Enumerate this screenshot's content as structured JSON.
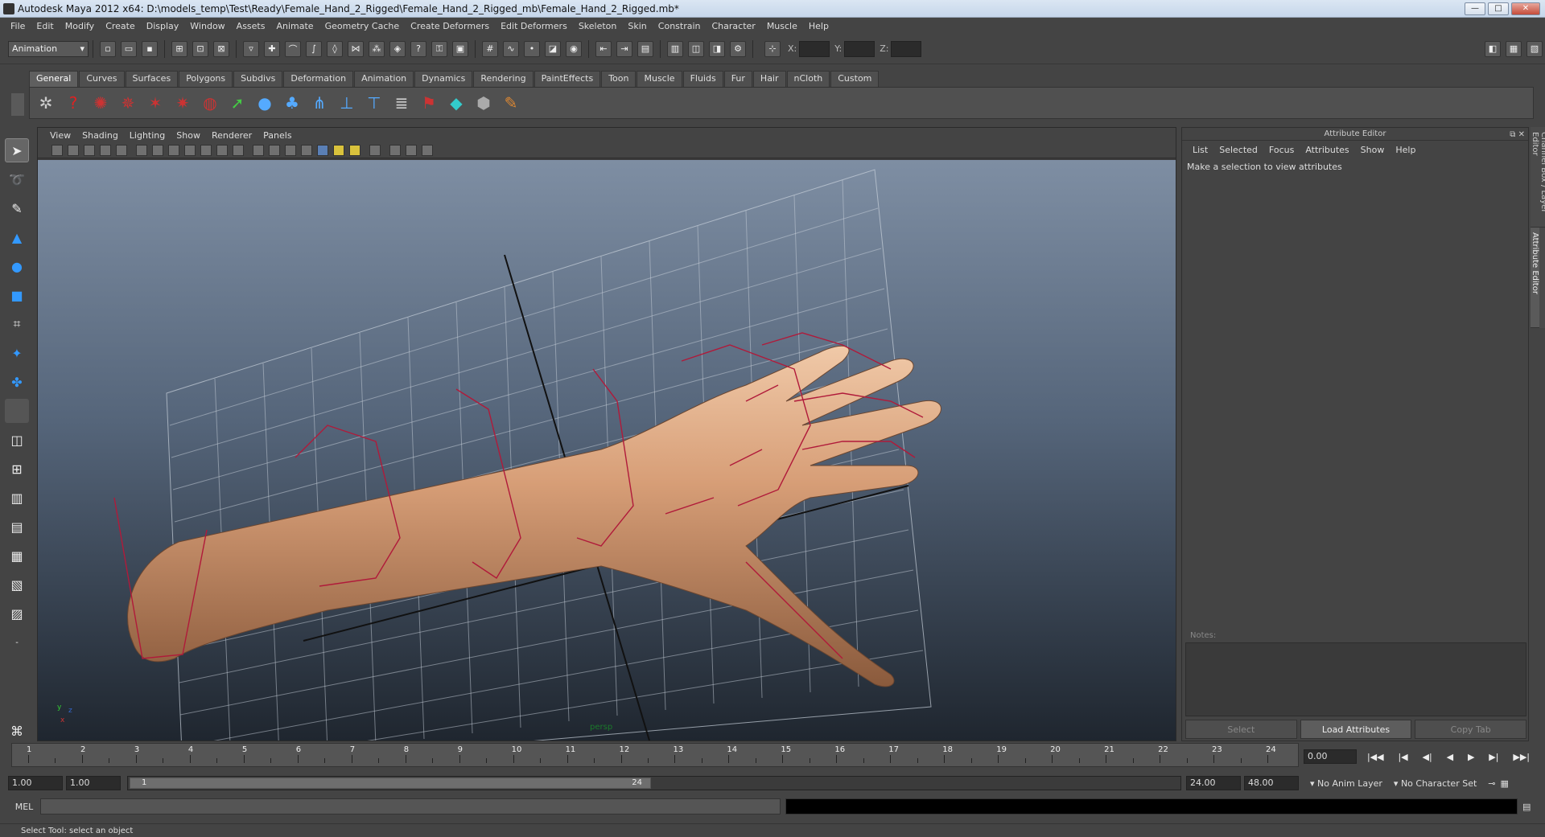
{
  "window": {
    "title": "Autodesk Maya 2012 x64: D:\\models_temp\\Test\\Ready\\Female_Hand_2_Rigged\\Female_Hand_2_Rigged_mb\\Female_Hand_2_Rigged.mb*",
    "min": "—",
    "max": "□",
    "close": "✕"
  },
  "menubar": [
    "File",
    "Edit",
    "Modify",
    "Create",
    "Display",
    "Window",
    "Assets",
    "Animate",
    "Geometry Cache",
    "Create Deformers",
    "Edit Deformers",
    "Skeleton",
    "Skin",
    "Constrain",
    "Character",
    "Muscle",
    "Help"
  ],
  "statusline": {
    "mode": "Animation",
    "x_label": "X:",
    "y_label": "Y:",
    "z_label": "Z:"
  },
  "shelf": {
    "tabs": [
      "General",
      "Curves",
      "Surfaces",
      "Polygons",
      "Subdivs",
      "Deformation",
      "Animation",
      "Dynamics",
      "Rendering",
      "PaintEffects",
      "Toon",
      "Muscle",
      "Fluids",
      "Fur",
      "Hair",
      "nCloth",
      "Custom"
    ],
    "active_tab": "General",
    "icons": [
      "render-icon",
      "help-icon",
      "joint-tool-icon",
      "ik-handle-icon",
      "ik-spline-icon",
      "skin-icon",
      "hypershade-icon",
      "redo-icon",
      "sphere-icon",
      "cluster-icon",
      "lattice-icon",
      "wrap-icon",
      "bend-icon",
      "list-icon",
      "character-icon",
      "shader-icon",
      "paint-icon"
    ]
  },
  "viewport": {
    "menu": [
      "View",
      "Shading",
      "Lighting",
      "Show",
      "Renderer",
      "Panels"
    ],
    "camera": "persp"
  },
  "attribute_editor": {
    "title": "Attribute Editor",
    "menu": [
      "List",
      "Selected",
      "Focus",
      "Attributes",
      "Show",
      "Help"
    ],
    "message": "Make a selection to view attributes",
    "notes_label": "Notes:",
    "buttons": [
      "Select",
      "Load Attributes",
      "Copy Tab"
    ]
  },
  "side_tabs": [
    "Channel Box / Layer Editor",
    "Attribute Editor"
  ],
  "timeline": {
    "ticks": [
      "1",
      "2",
      "3",
      "4",
      "5",
      "6",
      "7",
      "8",
      "9",
      "10",
      "11",
      "12",
      "13",
      "14",
      "15",
      "16",
      "17",
      "18",
      "19",
      "20",
      "21",
      "22",
      "23",
      "24"
    ],
    "current_time": "0.00",
    "play_buttons": [
      "|◀◀",
      "|◀",
      "◀|",
      "◀",
      "▶",
      "▶|",
      "▶▶|"
    ]
  },
  "range": {
    "start": "1.00",
    "playback_start": "1.00",
    "range_start_label": "1",
    "range_end_label": "24",
    "playback_end": "24.00",
    "end": "48.00",
    "anim_layer": "No Anim Layer",
    "character_set": "No Character Set"
  },
  "command": {
    "label": "MEL"
  },
  "help_line": "Select Tool: select an object"
}
